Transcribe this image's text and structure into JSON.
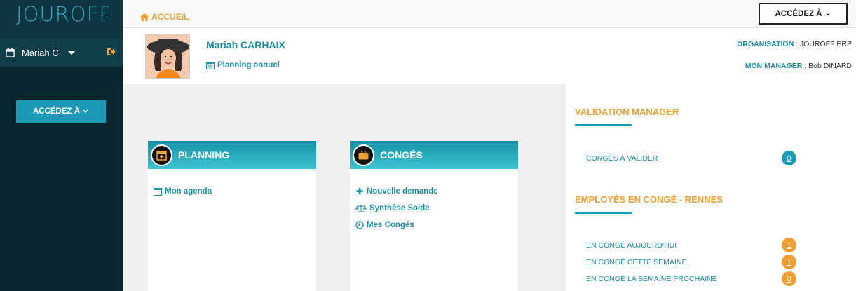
{
  "sidebar": {
    "brand": "JOUROFF",
    "user_name": "Mariah C",
    "access_button": "ACCÉDEZ À"
  },
  "topbar": {
    "home_label": "ACCUEIL",
    "access_button": "ACCÉDEZ À"
  },
  "profile": {
    "name": "Mariah CARHAIX",
    "planning_link": "Planning annuel",
    "organisation_label": "ORGANISATION",
    "organisation_value": " : JOUROFF ERP",
    "manager_label": "MON MANAGER",
    "manager_value": " : Bob DINARD"
  },
  "cards": {
    "planning": {
      "title": "PLANNING",
      "links": [
        "Mon agenda"
      ]
    },
    "conges": {
      "title": "CONGÉS",
      "links": [
        "Nouvelle demande",
        "Synthèse Solde",
        "Mes Congés"
      ]
    }
  },
  "validation": {
    "title": "VALIDATION MANAGER",
    "rows": [
      {
        "label": "CONGÉS À VALIDER",
        "count": "0",
        "color": "#1a9ab4"
      }
    ]
  },
  "absences": {
    "title": "EMPLOYÉS EN CONGÉ - RENNES",
    "rows": [
      {
        "label": "EN CONGÉ AUJOURD'HUI",
        "count": "1",
        "color": "#f0a030"
      },
      {
        "label": "EN CONGÉ CETTE SEMAINE",
        "count": "1",
        "color": "#f0a030"
      },
      {
        "label": "EN CONGÉ LA SEMAINE PROCHAINE",
        "count": "0",
        "color": "#f0a030"
      }
    ]
  },
  "colors": {
    "accent": "#1a9ab4",
    "orange": "#f0a030",
    "sidebar_bg": "#07262d"
  }
}
